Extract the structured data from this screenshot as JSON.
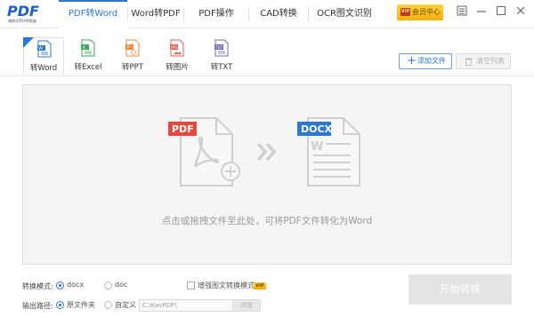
{
  "app": {
    "logo_text": "PDF",
    "logo_sub": "嗨格式PDF转换器"
  },
  "nav": {
    "tabs": [
      {
        "label": "PDF转Word",
        "active": true
      },
      {
        "label": "Word转PDF",
        "active": false
      },
      {
        "label": "PDF操作",
        "active": false
      },
      {
        "label": "CAD转换",
        "active": false
      },
      {
        "label": "OCR图文识别",
        "active": false
      }
    ],
    "vip_label": "会员中心",
    "vip_badge": "VIP"
  },
  "window_controls": [
    "menu-icon",
    "minimize-icon",
    "maximize-icon",
    "close-icon"
  ],
  "types": {
    "items": [
      {
        "label": "转Word",
        "icon": "word-doc-icon",
        "color": "#2a77d6",
        "active": true,
        "tag": "NEW"
      },
      {
        "label": "转Excel",
        "icon": "excel-doc-icon",
        "color": "#3aa65a",
        "active": false
      },
      {
        "label": "转PPT",
        "icon": "ppt-doc-icon",
        "color": "#f08a3c",
        "active": false
      },
      {
        "label": "转图片",
        "icon": "image-doc-icon",
        "color": "#e85c4a",
        "active": false
      },
      {
        "label": "转TXT",
        "icon": "txt-doc-icon",
        "color": "#6d6fb8",
        "active": false
      }
    ]
  },
  "toolbar": {
    "add_label": "添加文件",
    "clear_label": "清空列表"
  },
  "dropzone": {
    "source_tag": "PDF",
    "target_tag": "DOCX",
    "hint": "点击或拖拽文件至此处，可将PDF文件转化为Word"
  },
  "options": {
    "format_label": "转换模式:",
    "format_options": [
      {
        "label": "docx",
        "selected": true
      },
      {
        "label": "doc",
        "selected": false
      }
    ],
    "enhance_label": "增强图文转换模式",
    "enhance_checked": false,
    "enhance_vip": "VIP",
    "output_label": "输出路径:",
    "output_options": [
      {
        "label": "原文件夹",
        "selected": true
      },
      {
        "label": "自定义",
        "selected": false
      }
    ],
    "path_value": "C:\\KavPDF\\",
    "browse_label": "浏览"
  },
  "start_label": "开始转换",
  "colors": {
    "accent": "#2a77d6",
    "pdf_red": "#e8483b",
    "docx_blue": "#2a77d6",
    "vip_gold": "#f6b00c"
  }
}
